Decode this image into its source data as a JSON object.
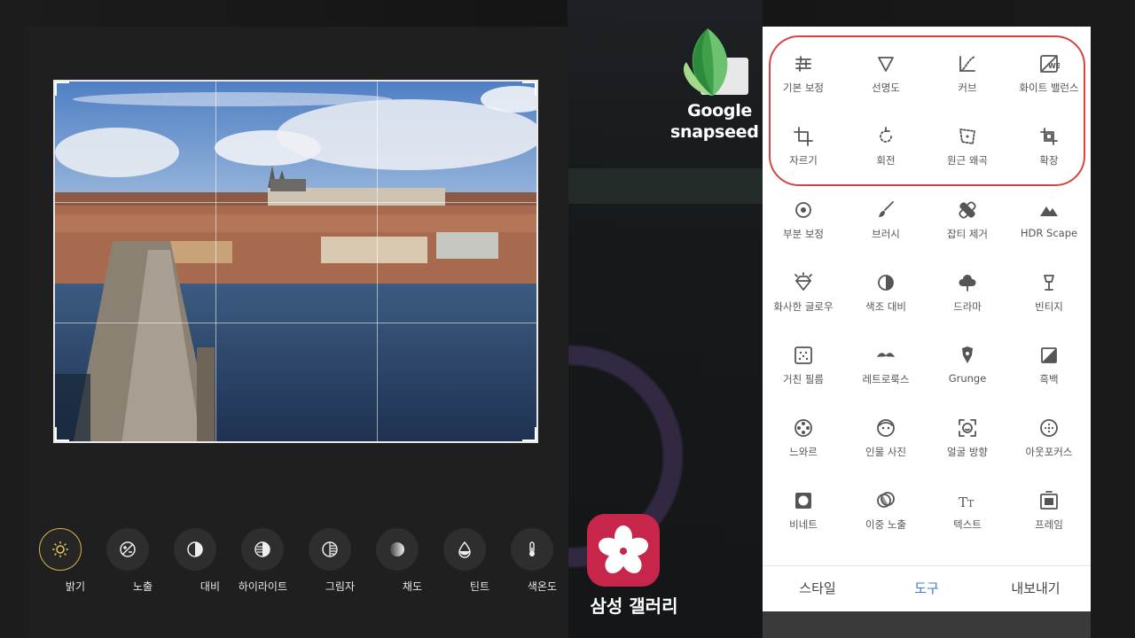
{
  "samsung_editor": {
    "adjustments": [
      {
        "label": "밝기",
        "icon": "brightness-icon",
        "active": true
      },
      {
        "label": "노출",
        "icon": "exposure-icon",
        "active": false
      },
      {
        "label": "대비",
        "icon": "contrast-icon",
        "active": false
      },
      {
        "label": "하이라이트",
        "icon": "highlights-icon",
        "active": false
      },
      {
        "label": "그림자",
        "icon": "shadows-icon",
        "active": false
      },
      {
        "label": "채도",
        "icon": "saturation-icon",
        "active": false
      },
      {
        "label": "틴트",
        "icon": "tint-icon",
        "active": false
      },
      {
        "label": "색온도",
        "icon": "temperature-icon",
        "active": false
      }
    ],
    "active_color": "#d9b54a"
  },
  "logos": {
    "snapseed_line1": "Google",
    "snapseed_line2": "snapseed",
    "gallery_name": "삼성 갤러리",
    "gallery_color": "#c8254a"
  },
  "snapseed_tools": [
    {
      "label": "기본 보정",
      "icon": "tune-image-icon"
    },
    {
      "label": "선명도",
      "icon": "details-icon"
    },
    {
      "label": "커브",
      "icon": "curves-icon"
    },
    {
      "label": "화이트 밸런스",
      "icon": "white-balance-icon"
    },
    {
      "label": "자르기",
      "icon": "crop-icon"
    },
    {
      "label": "회전",
      "icon": "rotate-icon"
    },
    {
      "label": "원근 왜곡",
      "icon": "perspective-icon"
    },
    {
      "label": "확장",
      "icon": "expand-icon"
    },
    {
      "label": "부분 보정",
      "icon": "selective-icon"
    },
    {
      "label": "브러시",
      "icon": "brush-icon"
    },
    {
      "label": "잡티 제거",
      "icon": "healing-icon"
    },
    {
      "label": "HDR Scape",
      "icon": "hdr-scape-icon"
    },
    {
      "label": "화사한 글로우",
      "icon": "glamour-glow-icon"
    },
    {
      "label": "색조 대비",
      "icon": "tonal-contrast-icon"
    },
    {
      "label": "드라마",
      "icon": "drama-icon"
    },
    {
      "label": "빈티지",
      "icon": "vintage-icon"
    },
    {
      "label": "거친 필름",
      "icon": "grainy-film-icon"
    },
    {
      "label": "레트로룩스",
      "icon": "retrolux-icon"
    },
    {
      "label": "Grunge",
      "icon": "grunge-icon"
    },
    {
      "label": "흑백",
      "icon": "black-white-icon"
    },
    {
      "label": "느와르",
      "icon": "noir-icon"
    },
    {
      "label": "인물 사진",
      "icon": "portrait-icon"
    },
    {
      "label": "얼굴 방향",
      "icon": "head-pose-icon"
    },
    {
      "label": "아웃포커스",
      "icon": "lens-blur-icon"
    },
    {
      "label": "비네트",
      "icon": "vignette-icon"
    },
    {
      "label": "이중 노출",
      "icon": "double-exposure-icon"
    },
    {
      "label": "텍스트",
      "icon": "text-icon"
    },
    {
      "label": "프레임",
      "icon": "frames-icon"
    }
  ],
  "tabs": [
    {
      "label": "스타일",
      "active": false
    },
    {
      "label": "도구",
      "active": true
    },
    {
      "label": "내보내기",
      "active": false
    }
  ],
  "accent": "#3d7bd9",
  "highlight_color": "#d9423f"
}
